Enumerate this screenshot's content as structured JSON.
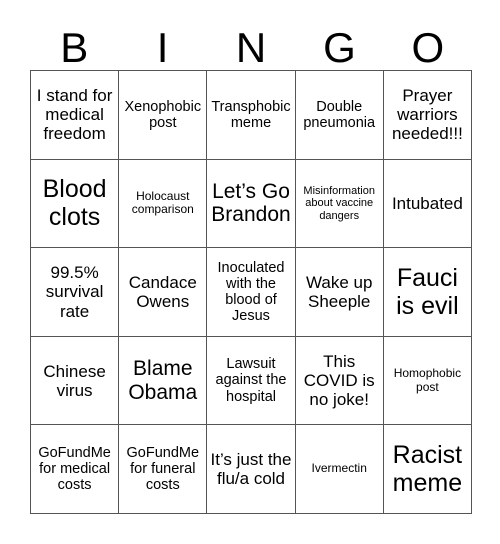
{
  "card": {
    "title_letters": [
      "B",
      "I",
      "N",
      "G",
      "O"
    ],
    "grid_size": 5,
    "colors": {
      "background": "#ffffff",
      "text": "#000000",
      "border": "#555555"
    },
    "cells": [
      [
        {
          "text": "I stand for medical freedom",
          "size": "md"
        },
        {
          "text": "Xenophobic post",
          "size": "sm"
        },
        {
          "text": "Transphobic meme",
          "size": "sm"
        },
        {
          "text": "Double pneumonia",
          "size": "sm"
        },
        {
          "text": "Prayer warriors needed!!!",
          "size": "md"
        }
      ],
      [
        {
          "text": "Blood clots",
          "size": "xl"
        },
        {
          "text": "Holocaust comparison",
          "size": "xs"
        },
        {
          "text": "Let’s Go Brandon",
          "size": "lg"
        },
        {
          "text": "Misinformation about vaccine dangers",
          "size": "xxs"
        },
        {
          "text": "Intubated",
          "size": "md"
        }
      ],
      [
        {
          "text": "99.5% survival rate",
          "size": "md"
        },
        {
          "text": "Candace Owens",
          "size": "md"
        },
        {
          "text": "Inoculated with the blood of Jesus",
          "size": "sm"
        },
        {
          "text": "Wake up Sheeple",
          "size": "md"
        },
        {
          "text": "Fauci is evil",
          "size": "xl"
        }
      ],
      [
        {
          "text": "Chinese virus",
          "size": "md"
        },
        {
          "text": "Blame Obama",
          "size": "lg"
        },
        {
          "text": "Lawsuit against the hospital",
          "size": "sm"
        },
        {
          "text": "This COVID is no joke!",
          "size": "md"
        },
        {
          "text": "Homophobic post",
          "size": "xs"
        }
      ],
      [
        {
          "text": "GoFundMe for medical costs",
          "size": "sm"
        },
        {
          "text": "GoFundMe for funeral costs",
          "size": "sm"
        },
        {
          "text": "It’s just the flu/a cold",
          "size": "md"
        },
        {
          "text": "Ivermectin",
          "size": "xs"
        },
        {
          "text": "Racist meme",
          "size": "xl"
        }
      ]
    ]
  }
}
